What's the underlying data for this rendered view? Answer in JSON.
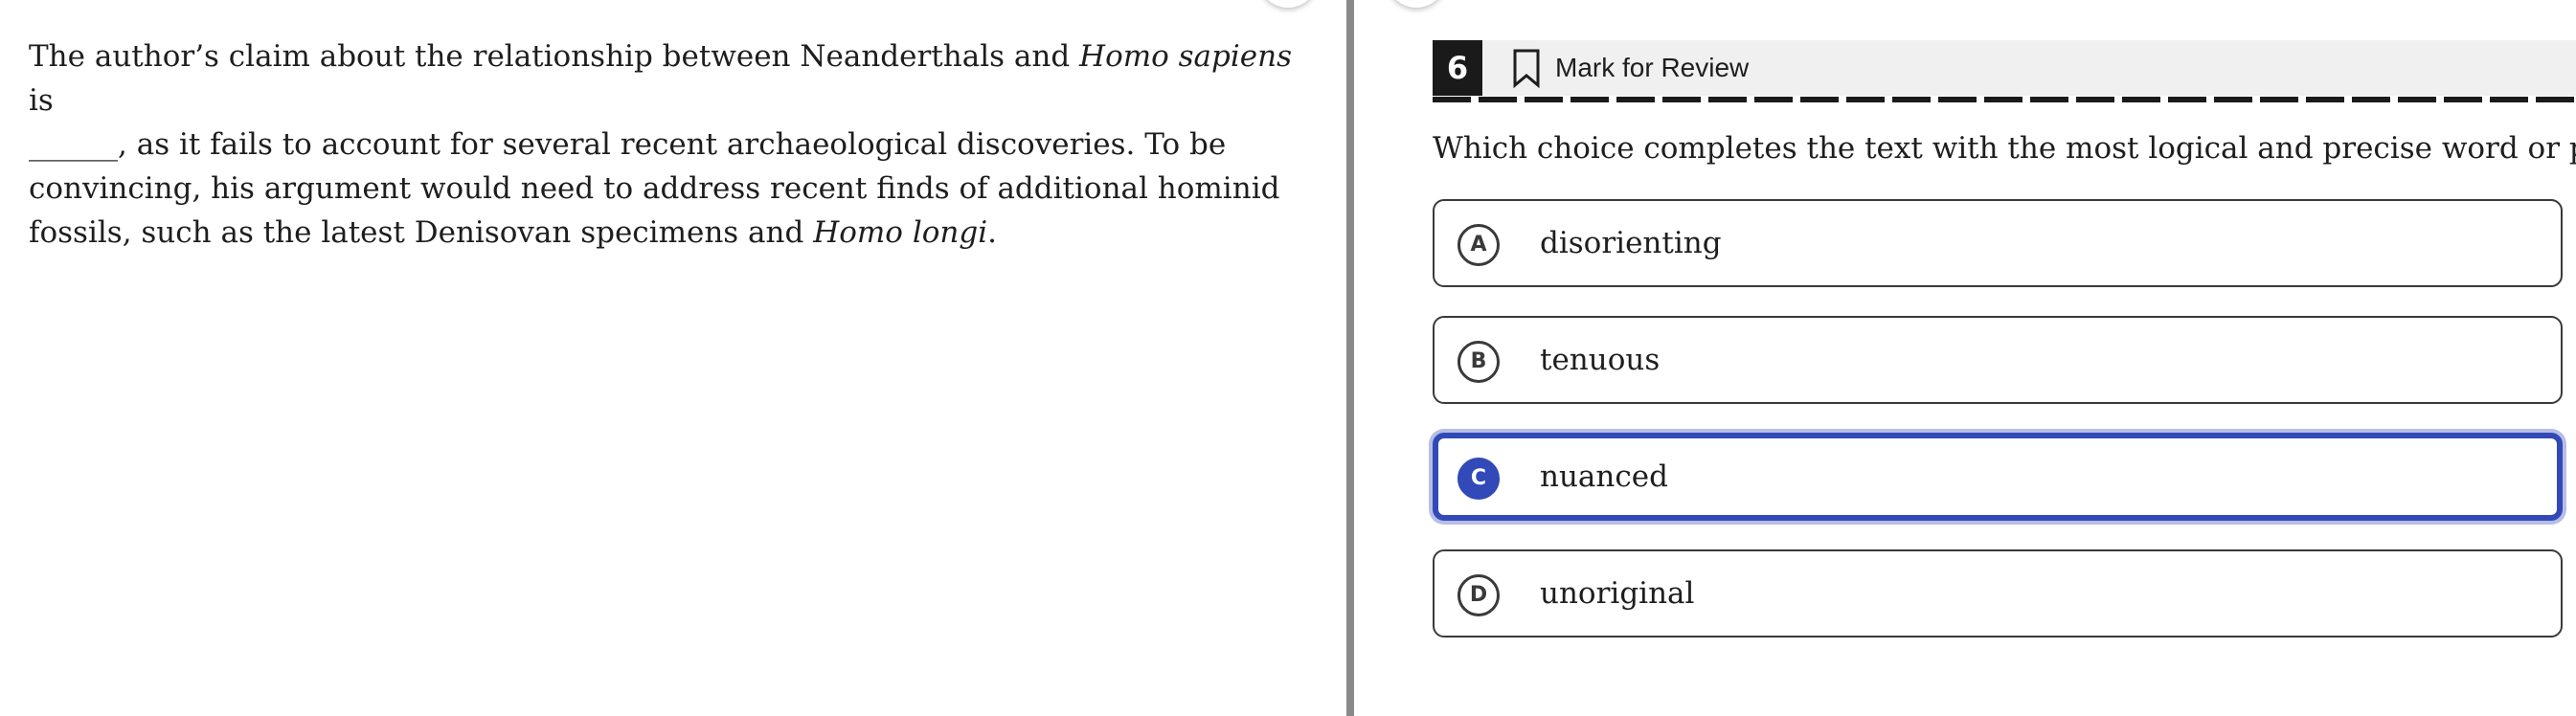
{
  "passage": {
    "line1_pre": "The author’s claim about the relationship between Neanderthals and ",
    "line1_italic": "Homo sapiens",
    "line1_post": " is",
    "line2": "______, as it fails to account for several recent archaeological discoveries. To be",
    "line3": "convincing, his argument would need to address recent finds of additional hominid",
    "line4_pre": "fossils, such as the latest Denisovan specimens and ",
    "line4_italic": "Homo longi",
    "line4_post": "."
  },
  "question": {
    "number": "6",
    "mark_for_review_label": "Mark for Review",
    "prompt": "Which choice completes the text with the most logical and precise word or phrase?",
    "choices": [
      {
        "letter": "A",
        "text": "disorienting",
        "selected": false
      },
      {
        "letter": "B",
        "text": "tenuous",
        "selected": false
      },
      {
        "letter": "C",
        "text": "nuanced",
        "selected": true
      },
      {
        "letter": "D",
        "text": "unoriginal",
        "selected": false
      }
    ]
  },
  "colors": {
    "selected_accent": "#3249b8",
    "selected_glow": "#b6bde6",
    "header_bg": "#f0f0f0",
    "number_bg": "#1a1a1a",
    "divider": "#8a8a8a"
  },
  "icons": {
    "bookmark": "bookmark-icon",
    "resize_handle": "resize-handle-icon"
  }
}
